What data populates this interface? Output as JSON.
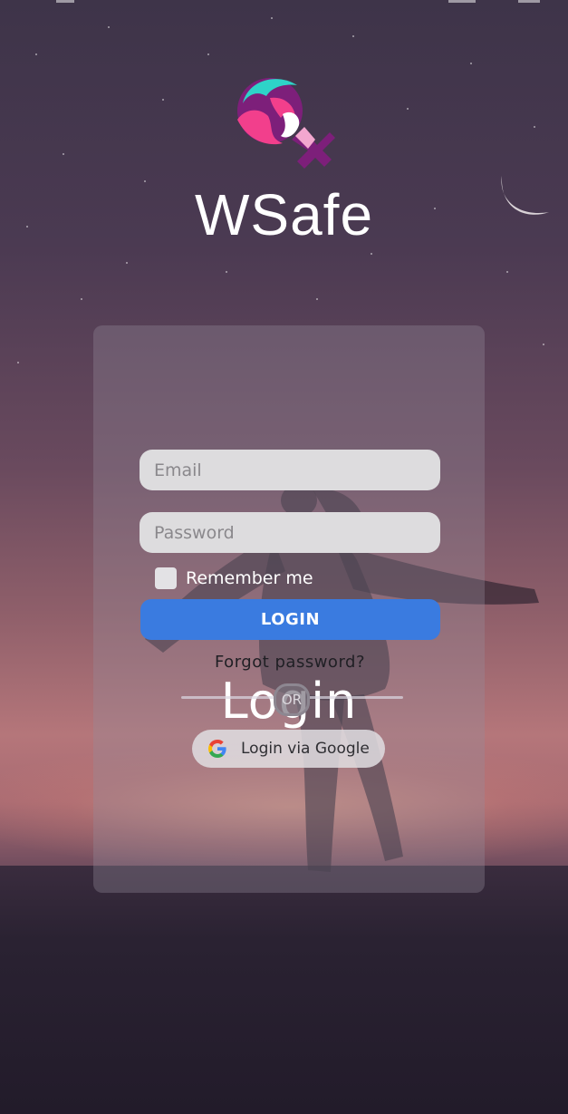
{
  "app": {
    "name": "WSafe"
  },
  "login": {
    "title": "Login",
    "email_placeholder": "Email",
    "password_placeholder": "Password",
    "remember_label": "Remember me",
    "remember_checked": false,
    "login_label": "LOGIN",
    "forgot_label": "Forgot password?",
    "divider_label": "OR",
    "google_label": "Login via Google"
  },
  "icons": {
    "logo": "wsafe-female-symbol-logo",
    "google": "google-g-icon",
    "moon": "crescent-moon"
  },
  "colors": {
    "login_button": "#3a7be0",
    "logo_teal": "#2ed3c8",
    "logo_pink": "#f23f8c",
    "logo_purple": "#7d1f7a"
  }
}
